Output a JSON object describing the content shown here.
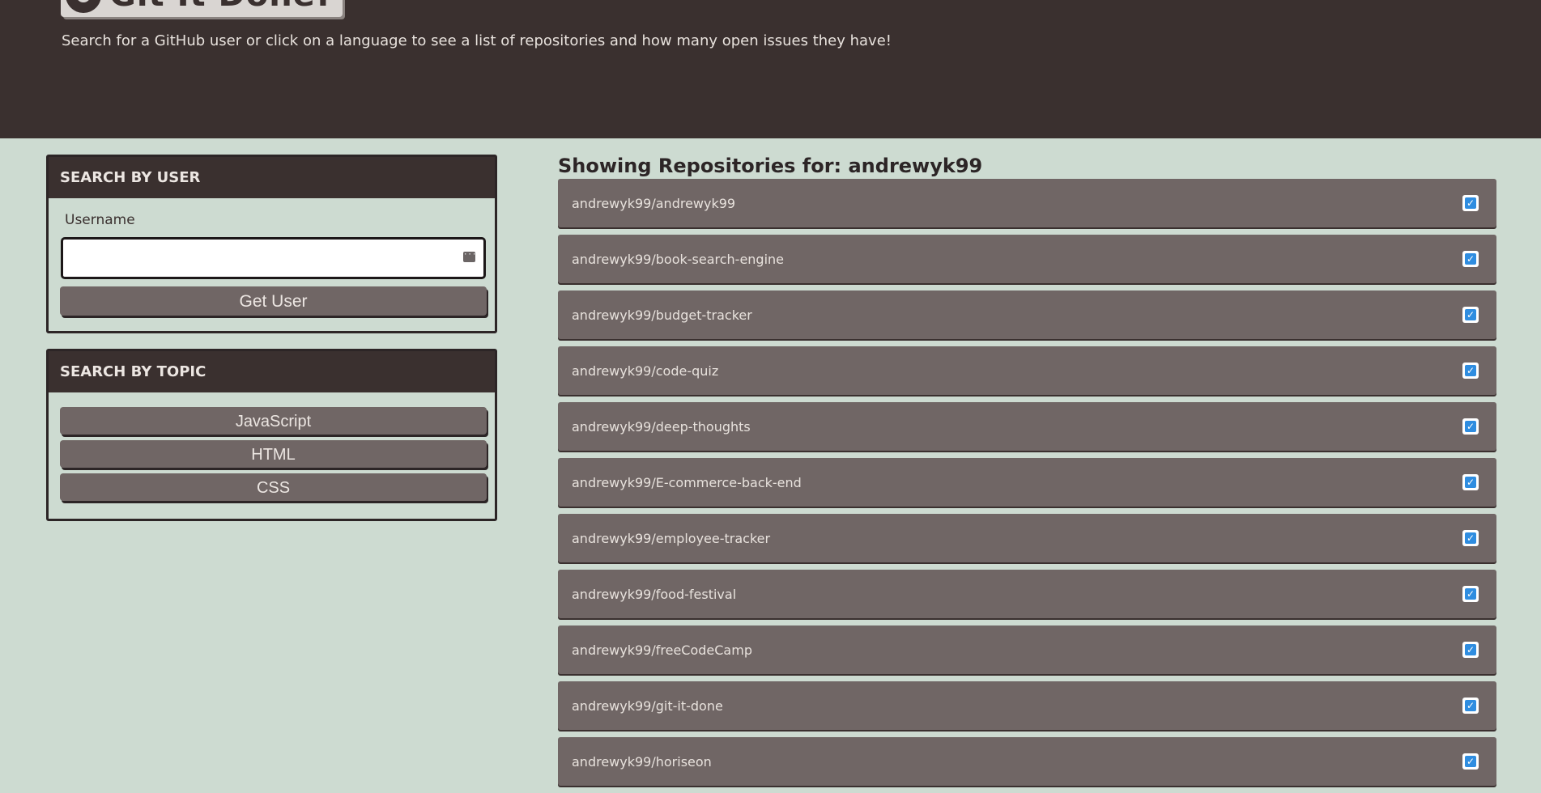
{
  "header": {
    "logo_text": "Git It Done!",
    "subtitle": "Search for a GitHub user or click on a language to see a list of repositories and how many open issues they have!"
  },
  "user_search": {
    "heading": "Search by user",
    "label": "Username",
    "input_value": "",
    "button_label": "Get User"
  },
  "topic_search": {
    "heading": "Search by topic",
    "topics": [
      "JavaScript",
      "HTML",
      "CSS"
    ]
  },
  "repos": {
    "title": "Showing Repositories for: andrewyk99",
    "items": [
      "andrewyk99/andrewyk99",
      "andrewyk99/book-search-engine",
      "andrewyk99/budget-tracker",
      "andrewyk99/code-quiz",
      "andrewyk99/deep-thoughts",
      "andrewyk99/E-commerce-back-end",
      "andrewyk99/employee-tracker",
      "andrewyk99/food-festival",
      "andrewyk99/freeCodeCamp",
      "andrewyk99/git-it-done",
      "andrewyk99/horiseon"
    ],
    "status_icon": "check-square-icon"
  },
  "colors": {
    "header_bg": "#3a302f",
    "page_bg": "#cddbd1",
    "button_bg": "#706665",
    "check_blue": "#2f8de0"
  }
}
